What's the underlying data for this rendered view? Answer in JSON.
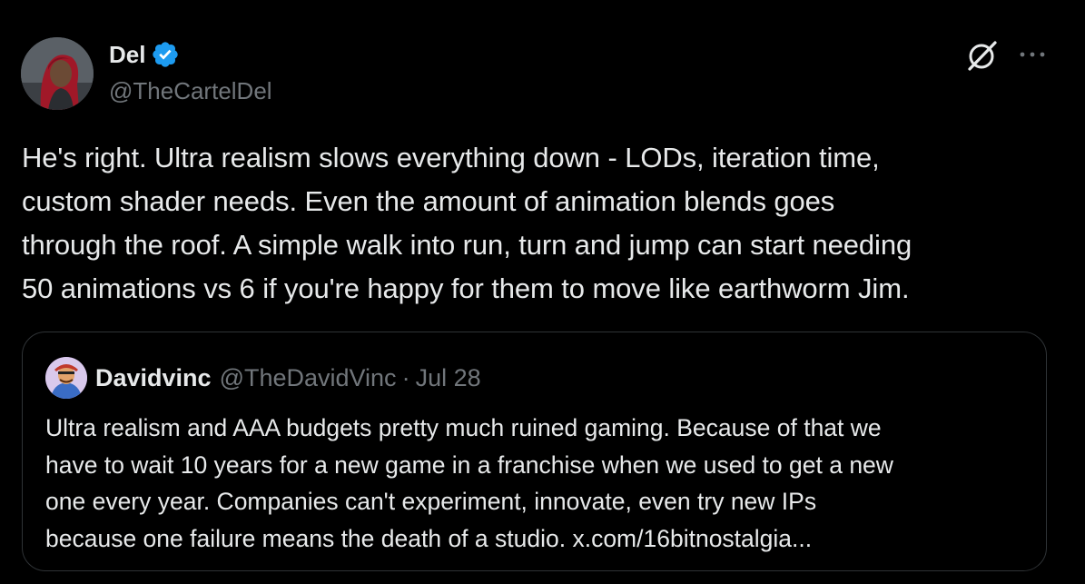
{
  "tweet": {
    "author": {
      "name": "Del",
      "handle": "@TheCartelDel",
      "verified": true
    },
    "text_lines": [
      "He's right. Ultra realism slows everything down - LODs, iteration time,",
      "custom shader needs. Even the amount of animation blends goes",
      "through the roof. A simple walk into run, turn and jump can start needing",
      "50 animations vs 6 if you're happy for them to move like earthworm Jim."
    ],
    "icons": {
      "grok": "grok-icon",
      "more": "more-icon",
      "verified": "verified-badge-icon"
    }
  },
  "quote": {
    "author": {
      "name": "Davidvinc",
      "handle": "@TheDavidVinc"
    },
    "separator": "·",
    "date": "Jul 28",
    "text_lines": [
      "Ultra realism and AAA budgets pretty much ruined gaming. Because of that we",
      "have to wait 10 years for a new game in a franchise when we used to get a new",
      "one every year. Companies can't experiment, innovate, even try new IPs",
      "because one failure means the death of a studio. x.com/16bitnostalgia..."
    ]
  },
  "colors": {
    "background": "#000000",
    "primary_text": "#e7e9ea",
    "secondary_text": "#71767b",
    "verified_blue": "#1d9bf0",
    "border": "#2f3336"
  }
}
